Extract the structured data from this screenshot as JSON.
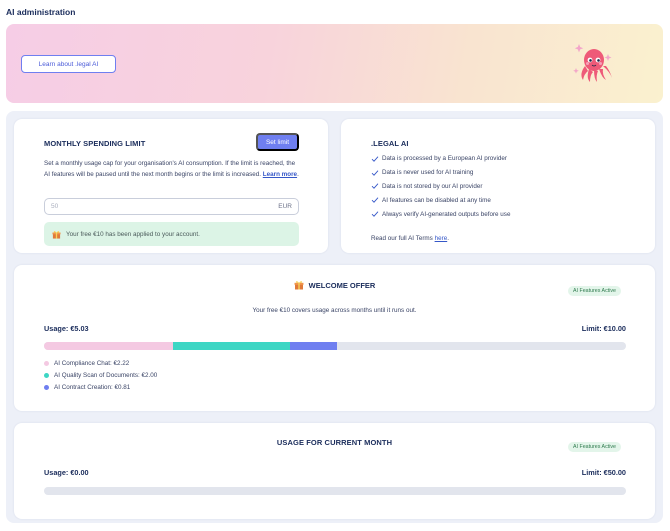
{
  "page": {
    "title": "AI administration"
  },
  "banner": {
    "learn_button": "Learn about .legal AI",
    "mascot_icon": "octopus-mascot-icon"
  },
  "spending_limit": {
    "title": "MONTHLY SPENDING LIMIT",
    "set_limit_button": "Set limit",
    "description": "Set a monthly usage cap for your organisation's AI consumption. If the limit is reached, the AI features will be paused until the next month begins or the limit is increased.",
    "learn_more": "Learn more",
    "learn_more_suffix": ".",
    "input_placeholder": "50",
    "currency": "EUR",
    "applied_message": "Your free €10 has been applied to your account."
  },
  "legal_ai": {
    "title": ".LEGAL AI",
    "features": [
      "Data is processed by a European AI provider",
      "Data is never used for AI training",
      "Data is not stored by our AI provider",
      "AI features can be disabled at any time",
      "Always verify AI-generated outputs before use"
    ],
    "terms_prefix": "Read our full AI Terms ",
    "terms_link": "here",
    "terms_suffix": "."
  },
  "welcome_offer": {
    "title": "WELCOME OFFER",
    "badge": "AI Features Active",
    "subtitle": "Your free €10 covers usage across months until it runs out.",
    "usage_label": "Usage: €5.03",
    "limit_label": "Limit: €10.00",
    "usage_value": 5.03,
    "limit_value": 10.0,
    "breakdown": [
      {
        "label": "AI Compliance Chat: €2.22",
        "value": 2.22,
        "color": "#f4c9e2"
      },
      {
        "label": "AI Quality Scan of Documents: €2.00",
        "value": 2.0,
        "color": "#3dd6c4"
      },
      {
        "label": "AI Contract Creation: €0.81",
        "value": 0.81,
        "color": "#6f7ff0"
      }
    ]
  },
  "current_month": {
    "title": "USAGE FOR CURRENT MONTH",
    "badge": "AI Features Active",
    "usage_label": "Usage: €0.00",
    "limit_label": "Limit: €50.00",
    "usage_value": 0.0,
    "limit_value": 50.0
  },
  "colors": {
    "accent": "#6f7ff0",
    "title": "#1a2c5b",
    "success_bg": "#dcf4e6"
  }
}
